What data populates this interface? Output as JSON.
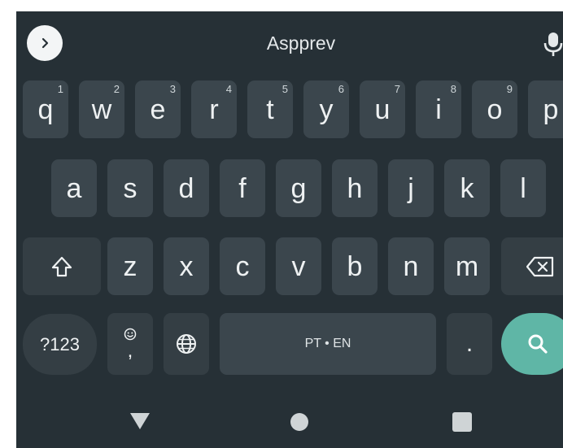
{
  "suggestion_strip": {
    "suggestion": "Aspprev",
    "expand_icon": "chevron-right-icon",
    "voice_icon": "microphone-icon"
  },
  "rows": [
    [
      {
        "label": "q",
        "hint": "1"
      },
      {
        "label": "w",
        "hint": "2"
      },
      {
        "label": "e",
        "hint": "3"
      },
      {
        "label": "r",
        "hint": "4"
      },
      {
        "label": "t",
        "hint": "5"
      },
      {
        "label": "y",
        "hint": "6"
      },
      {
        "label": "u",
        "hint": "7"
      },
      {
        "label": "i",
        "hint": "8"
      },
      {
        "label": "o",
        "hint": "9"
      },
      {
        "label": "p",
        "hint": ""
      }
    ],
    [
      {
        "label": "a"
      },
      {
        "label": "s"
      },
      {
        "label": "d"
      },
      {
        "label": "f"
      },
      {
        "label": "g"
      },
      {
        "label": "h"
      },
      {
        "label": "j"
      },
      {
        "label": "k"
      },
      {
        "label": "l"
      }
    ],
    [
      {
        "label": "z"
      },
      {
        "label": "x"
      },
      {
        "label": "c"
      },
      {
        "label": "v"
      },
      {
        "label": "b"
      },
      {
        "label": "n"
      },
      {
        "label": "m"
      }
    ]
  ],
  "function_keys": {
    "shift_icon": "shift-arrow-icon",
    "backspace_icon": "backspace-icon",
    "symbols_label": "?123",
    "emoji_icon": "smiley-icon",
    "comma_label": ",",
    "language_icon": "globe-icon",
    "space_label": "PT • EN",
    "period_label": ".",
    "search_icon": "search-icon"
  },
  "navigation_bar": {
    "back_icon": "triangle-back-icon",
    "home_icon": "circle-home-icon",
    "recents_icon": "square-recents-icon"
  },
  "colors": {
    "keyboard_background": "#263036",
    "key_background": "#3b464d",
    "key_text": "#eef1f2",
    "action_key": "#5fb6a6"
  }
}
